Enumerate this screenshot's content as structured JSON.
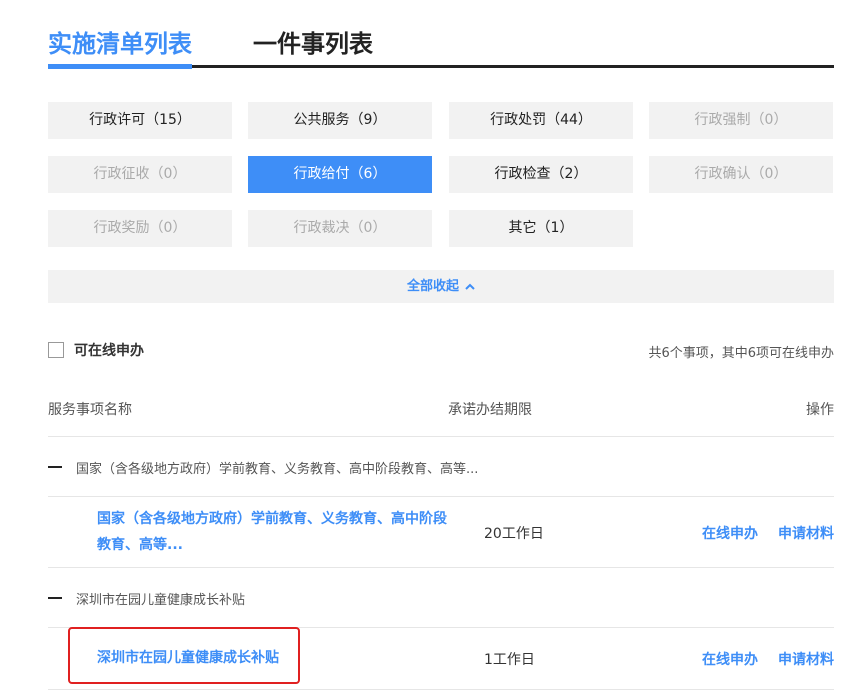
{
  "tabs": [
    {
      "label": "实施清单列表",
      "active": true
    },
    {
      "label": "一件事列表",
      "active": false
    }
  ],
  "categories": [
    {
      "label": "行政许可（15）",
      "state": "normal"
    },
    {
      "label": "公共服务（9）",
      "state": "normal"
    },
    {
      "label": "行政处罚（44）",
      "state": "normal"
    },
    {
      "label": "行政强制（0）",
      "state": "disabled"
    },
    {
      "label": "行政征收（0）",
      "state": "disabled"
    },
    {
      "label": "行政给付（6）",
      "state": "active"
    },
    {
      "label": "行政检查（2）",
      "state": "normal"
    },
    {
      "label": "行政确认（0）",
      "state": "disabled"
    },
    {
      "label": "行政奖励（0）",
      "state": "disabled"
    },
    {
      "label": "行政裁决（0）",
      "state": "disabled"
    },
    {
      "label": "其它（1）",
      "state": "normal"
    }
  ],
  "collapse": {
    "label": "全部收起",
    "icon": "chevron-up-icon"
  },
  "filter": {
    "online_label": "可在线申办",
    "checked": false
  },
  "summary": "共6个事项，其中6项可在线申办",
  "table": {
    "headers": {
      "name": "服务事项名称",
      "deadline": "承诺办结期限",
      "op": "操作"
    },
    "groups": [
      {
        "title": "国家（含各级地方政府）学前教育、义务教育、高中阶段教育、高等...",
        "item": {
          "name_line1": "国家（含各级地方政府）学前教育、义务教育、高中阶段",
          "name_line2": "教育、高等...",
          "deadline": "20工作日",
          "online": "在线申办",
          "materials": "申请材料"
        }
      },
      {
        "title": "深圳市在园儿童健康成长补贴",
        "item": {
          "name_line1": "深圳市在园儿童健康成长补贴",
          "deadline": "1工作日",
          "online": "在线申办",
          "materials": "申请材料"
        }
      }
    ]
  },
  "colors": {
    "accent": "#3e8ef7",
    "highlight": "#e02020",
    "muted": "#aaaaaa"
  }
}
